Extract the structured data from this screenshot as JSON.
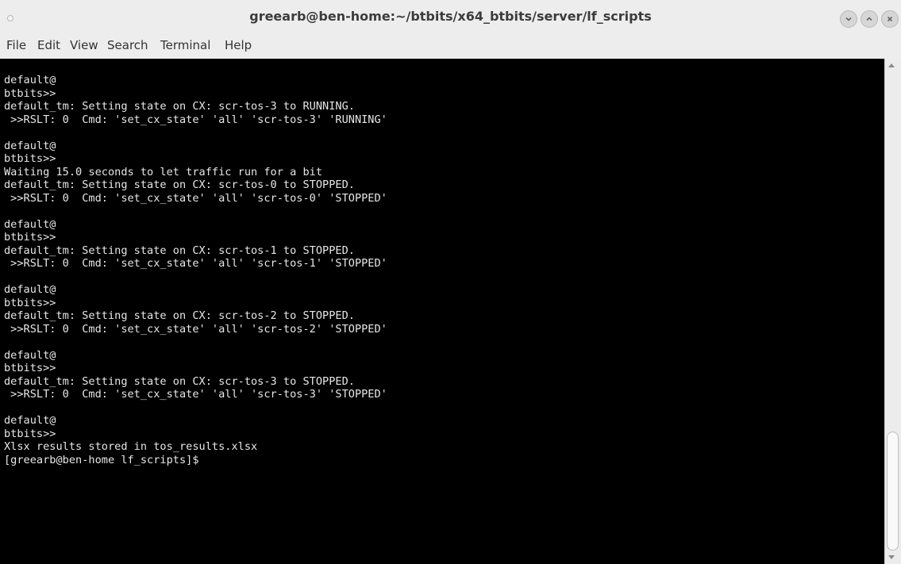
{
  "window": {
    "title": "greearb@ben-home:~/btbits/x64_btbits/server/lf_scripts",
    "buttons": {
      "minimize_icon": "chevron-down-icon",
      "maximize_icon": "chevron-up-icon",
      "close_icon": "close-icon"
    }
  },
  "menu": {
    "items": [
      "File",
      "Edit",
      "View",
      "Search",
      "Terminal",
      "Help"
    ]
  },
  "terminal": {
    "background": "#000000",
    "foreground": "#e6e6e6",
    "lines": [
      "default@",
      "btbits>>",
      "default_tm: Setting state on CX: scr-tos-3 to RUNNING.",
      " >>RSLT: 0  Cmd: 'set_cx_state' 'all' 'scr-tos-3' 'RUNNING'",
      "",
      "default@",
      "btbits>>",
      "Waiting 15.0 seconds to let traffic run for a bit",
      "default_tm: Setting state on CX: scr-tos-0 to STOPPED.",
      " >>RSLT: 0  Cmd: 'set_cx_state' 'all' 'scr-tos-0' 'STOPPED'",
      "",
      "default@",
      "btbits>>",
      "default_tm: Setting state on CX: scr-tos-1 to STOPPED.",
      " >>RSLT: 0  Cmd: 'set_cx_state' 'all' 'scr-tos-1' 'STOPPED'",
      "",
      "default@",
      "btbits>>",
      "default_tm: Setting state on CX: scr-tos-2 to STOPPED.",
      " >>RSLT: 0  Cmd: 'set_cx_state' 'all' 'scr-tos-2' 'STOPPED'",
      "",
      "default@",
      "btbits>>",
      "default_tm: Setting state on CX: scr-tos-3 to STOPPED.",
      " >>RSLT: 0  Cmd: 'set_cx_state' 'all' 'scr-tos-3' 'STOPPED'",
      "",
      "default@",
      "btbits>>",
      "Xlsx results stored in tos_results.xlsx",
      "[greearb@ben-home lf_scripts]$"
    ]
  }
}
